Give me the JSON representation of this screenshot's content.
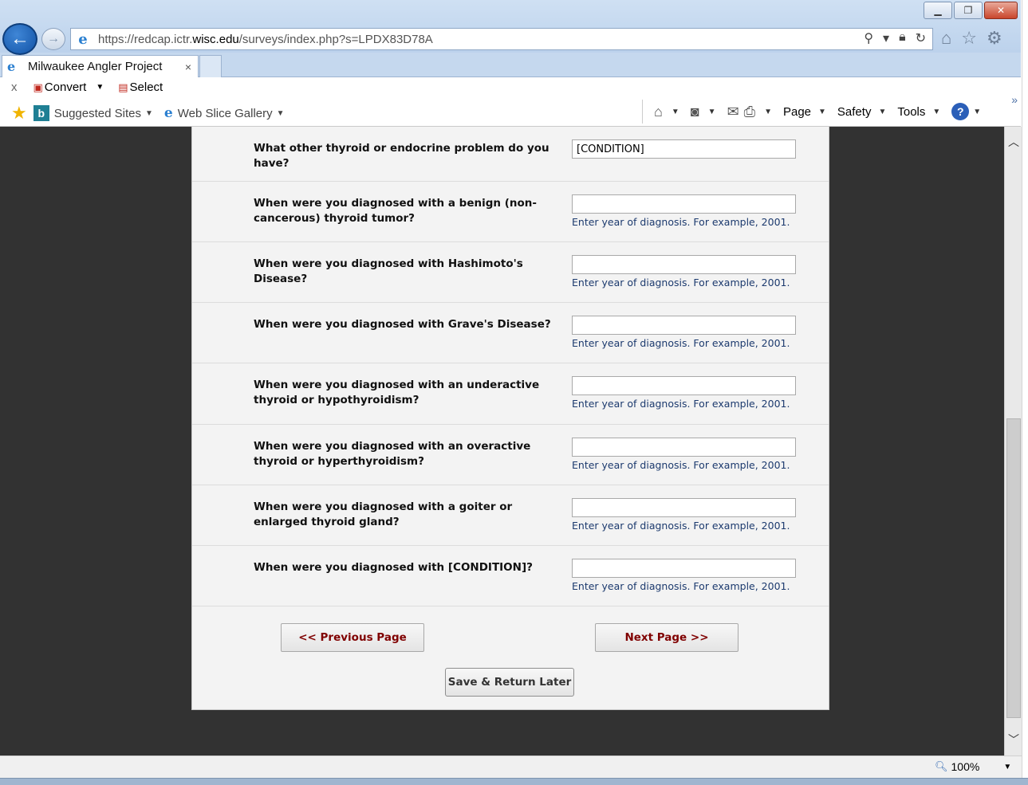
{
  "browser": {
    "url_prefix": "https://redcap.ictr.",
    "url_domain": "wisc.edu",
    "url_suffix": "/surveys/index.php?s=LPDX83D78A",
    "tab_title": "Milwaukee Angler Project",
    "tab_close": "×",
    "zoom": "100%"
  },
  "command_bar": {
    "close": "x",
    "convert": "Convert",
    "select": "Select",
    "suggested_sites": "Suggested Sites",
    "web_slice_gallery": "Web Slice Gallery",
    "page_menu": "Page",
    "safety_menu": "Safety",
    "tools_menu": "Tools"
  },
  "survey": {
    "questions": [
      {
        "label": "What other thyroid or endocrine problem do you have?",
        "value": "[CONDITION]",
        "note": ""
      },
      {
        "label": "When were you diagnosed with a benign (non-cancerous) thyroid tumor?",
        "value": "",
        "note": "Enter year of diagnosis. For example, 2001."
      },
      {
        "label": "When were you diagnosed with Hashimoto's Disease?",
        "value": "",
        "note": "Enter year of diagnosis. For example, 2001."
      },
      {
        "label": "When were you diagnosed with Grave's Disease?",
        "value": "",
        "note": "Enter year of diagnosis. For example, 2001."
      },
      {
        "label": "When were you diagnosed with an underactive thyroid or hypothyroidism?",
        "value": "",
        "note": "Enter year of diagnosis. For example, 2001."
      },
      {
        "label": "When were you diagnosed with an overactive thyroid or hyperthyroidism?",
        "value": "",
        "note": "Enter year of diagnosis. For example, 2001."
      },
      {
        "label": "When were you diagnosed with a goiter or enlarged thyroid gland?",
        "value": "",
        "note": "Enter year of diagnosis. For example, 2001."
      },
      {
        "label": "When were you diagnosed with [CONDITION]?",
        "value": "",
        "note": "Enter year of diagnosis. For example, 2001."
      }
    ],
    "prev_button": "<< Previous Page",
    "next_button": "Next Page >>",
    "save_button": "Save & Return Later"
  },
  "colors": {
    "accent_button_text": "#800000",
    "note_text": "#1c3a6e",
    "page_background": "#323232"
  }
}
